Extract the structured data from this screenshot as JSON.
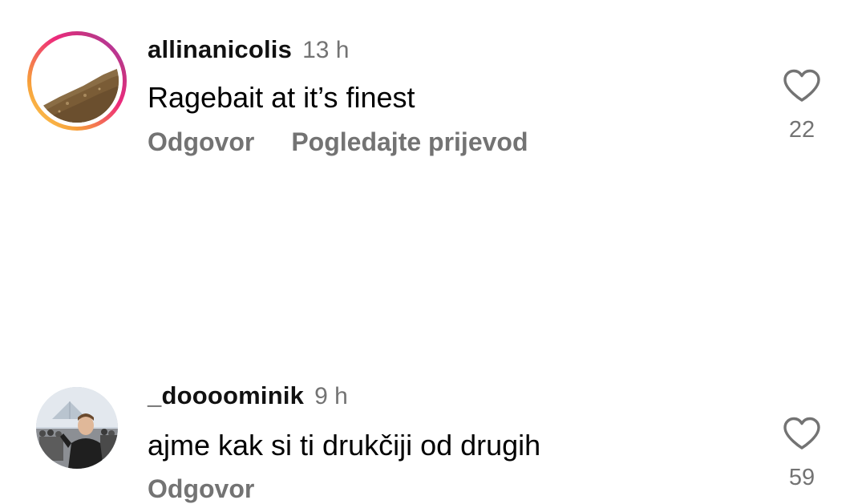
{
  "comments": [
    {
      "username": "allinanicolis",
      "time": "13 h",
      "text": "Ragebait at it’s finest",
      "actions": [
        "Odgovor",
        "Pogledajte prijevod"
      ],
      "likes": "22",
      "has_story_ring": true,
      "avatar_icon": "landscape-photo"
    },
    {
      "username": "_doooominik",
      "time": "9 h",
      "text": "ajme kak si ti drukčiji od drugih",
      "actions": [
        "Odgovor"
      ],
      "likes": "59",
      "has_story_ring": false,
      "avatar_icon": "person-photo"
    }
  ],
  "colors": {
    "secondary_text": "#737373",
    "story_ring_start": "#fdd35a",
    "story_ring_end": "#a23cc9"
  }
}
